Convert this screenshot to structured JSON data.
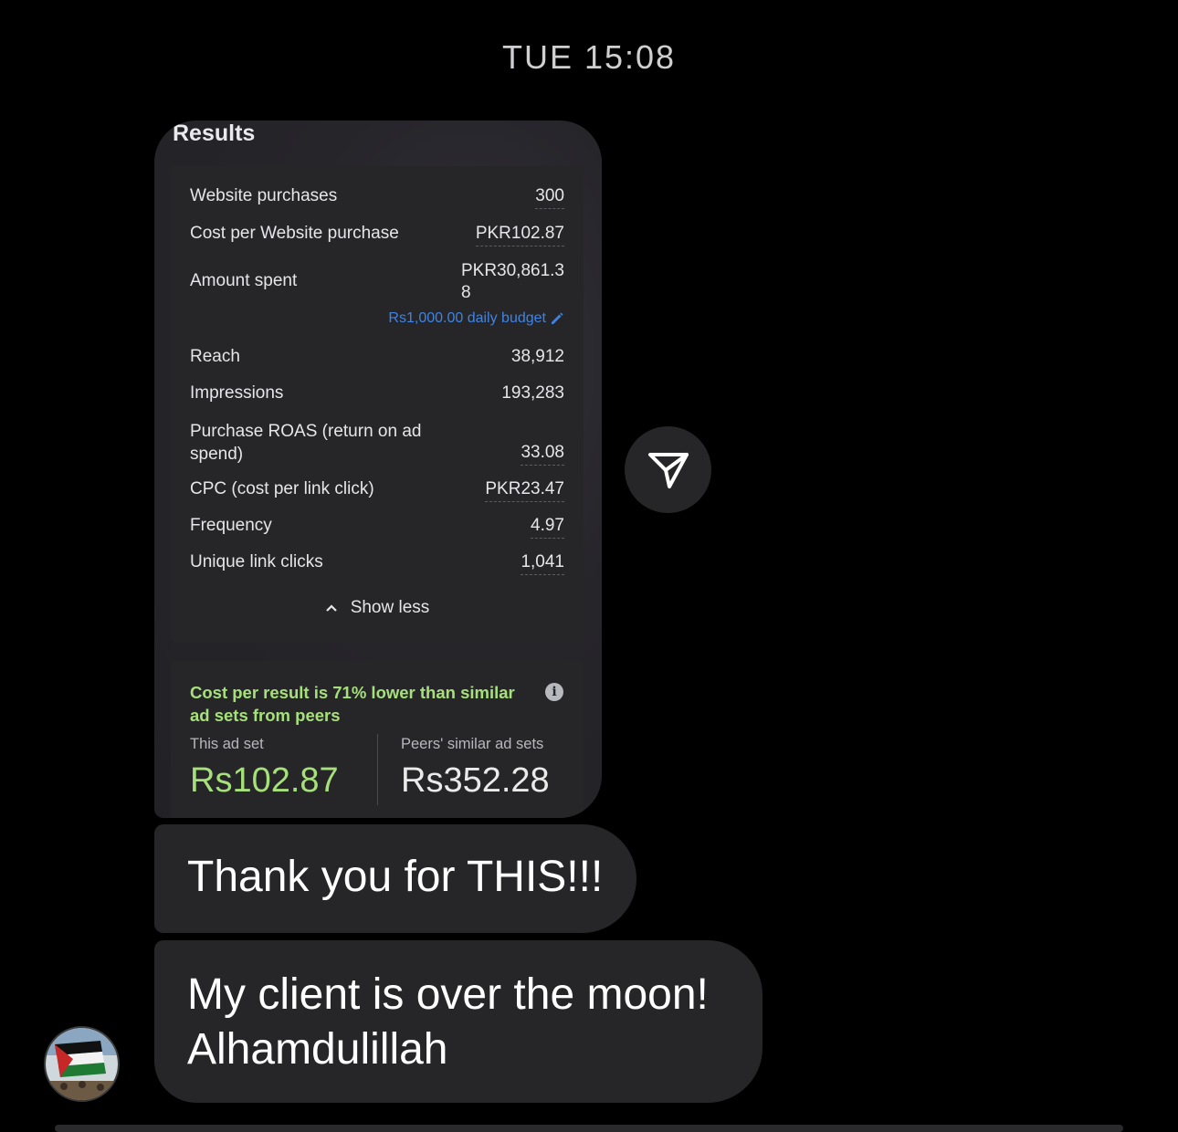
{
  "header": {
    "timestamp": "TUE 15:08"
  },
  "shared_screenshot": {
    "title": "Results",
    "metrics": [
      {
        "label": "Website purchases",
        "value": "300"
      },
      {
        "label": "Cost per Website purchase",
        "value": "PKR102.87"
      },
      {
        "label": "Amount spent",
        "value": "PKR30,861.3\n8"
      },
      {
        "label": "Reach",
        "value": "38,912"
      },
      {
        "label": "Impressions",
        "value": "193,283"
      },
      {
        "label": "Purchase ROAS (return on ad spend)",
        "value": "33.08"
      },
      {
        "label": "CPC (cost per link click)",
        "value": "PKR23.47"
      },
      {
        "label": "Frequency",
        "value": "4.97"
      },
      {
        "label": "Unique link clicks",
        "value": "1,041"
      }
    ],
    "budget_text": "Rs1,000.00 daily budget",
    "show_less": "Show less",
    "insight": "Cost per result is 71% lower than similar ad sets from peers",
    "this_ad_set_label": "This ad set",
    "this_ad_set_value": "Rs102.87",
    "peers_label": "Peers' similar ad sets",
    "peers_value": "Rs352.28"
  },
  "messages": [
    {
      "text": "Thank you for THIS!!!"
    },
    {
      "text": "My client is over the moon! Alhamdulillah"
    }
  ],
  "colors": {
    "accent_green": "#a6e07a",
    "link_blue": "#3d84e6",
    "bubble": "#262628"
  },
  "icons": {
    "share": "send-icon",
    "info": "info-icon",
    "chevron": "chevron-up-icon",
    "edit": "pencil-icon"
  }
}
